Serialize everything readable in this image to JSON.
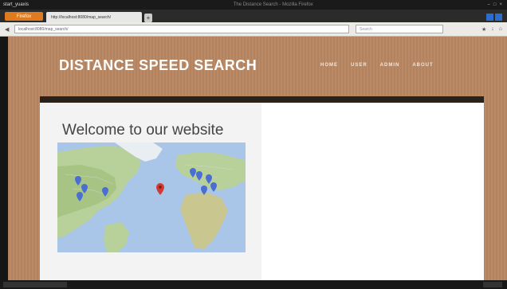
{
  "os_bar": {
    "left_label": "start_yuaxis",
    "window_title": "The Distance Search - Mozilla Firefox"
  },
  "browser": {
    "app_button_label": "Firefox",
    "tab_label": "http://localhost:8080/map_search/",
    "url": "localhost:8080/map_search/",
    "search_placeholder": "Search"
  },
  "site": {
    "title": "DISTANCE SPEED SEARCH",
    "nav": [
      "HOME",
      "USER",
      "ADMIN",
      "ABOUT"
    ]
  },
  "main": {
    "welcome_title": "Welcome to our website"
  },
  "colors": {
    "page_bg": "#b98763",
    "band": "#2a211a",
    "firefox_orange": "#e07a1f"
  }
}
